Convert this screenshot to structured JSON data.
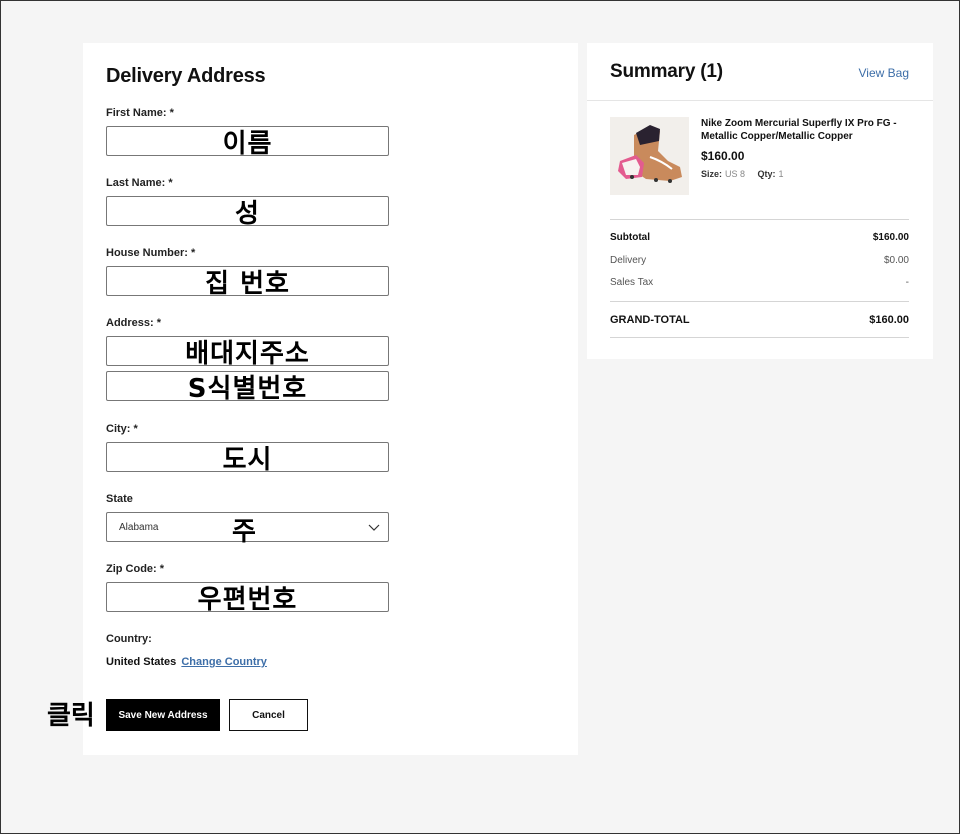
{
  "form": {
    "title": "Delivery Address",
    "fields": {
      "first_name": {
        "label": "First Name: *",
        "overlay": "이름"
      },
      "last_name": {
        "label": "Last Name: *",
        "overlay": "성"
      },
      "house_number": {
        "label": "House Number: *",
        "overlay": "집 번호"
      },
      "address": {
        "label": "Address: *",
        "overlay_line1": "배대지주소",
        "overlay_line2": "S식별번호"
      },
      "city": {
        "label": "City: *",
        "overlay": "도시"
      },
      "state": {
        "label": "State",
        "value": "Alabama",
        "overlay": "주"
      },
      "zip": {
        "label": "Zip Code: *",
        "overlay": "우편번호"
      }
    },
    "country": {
      "label": "Country:",
      "value": "United States",
      "change_link": "Change Country"
    },
    "save_button": "Save New Address",
    "cancel_button": "Cancel",
    "click_note": "클릭"
  },
  "summary": {
    "title": "Summary (1)",
    "view_bag": "View Bag",
    "product": {
      "name": "Nike Zoom Mercurial Superfly IX Pro FG - Metallic Copper/Metallic Copper",
      "price": "$160.00",
      "size_label": "Size:",
      "size_value": "US 8",
      "qty_label": "Qty:",
      "qty_value": "1"
    },
    "rows": {
      "subtotal": {
        "label": "Subtotal",
        "value": "$160.00"
      },
      "delivery": {
        "label": "Delivery",
        "value": "$0.00"
      },
      "sales_tax": {
        "label": "Sales Tax",
        "value": "-"
      },
      "grand_total": {
        "label": "GRAND-TOTAL",
        "value": "$160.00"
      }
    }
  },
  "colors": {
    "page_bg": "#f5f5f5",
    "link": "#3d6ea8",
    "primary_button": "#000000"
  }
}
